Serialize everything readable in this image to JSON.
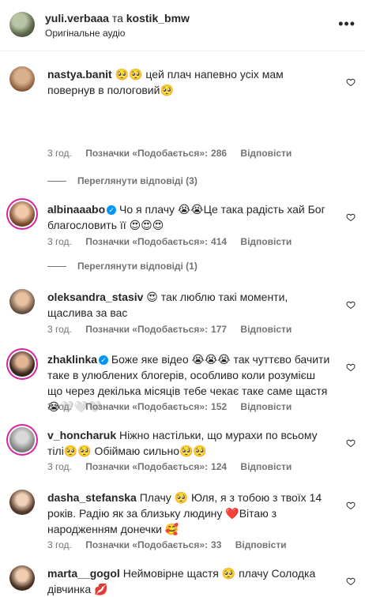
{
  "header": {
    "user1": "yuli.verbaaa",
    "separator": "та",
    "user2": "kostik_bmw",
    "audio": "Оригінальне аудіо",
    "more": "•••"
  },
  "labels": {
    "likes_prefix": "Позначки «Подобається»:",
    "reply": "Відповісти"
  },
  "comments": [
    {
      "user": "nastya.banit",
      "text": "🥺🥺 цей плач напевно усіх мам повернув в пологовий🥺",
      "time": "3 год.",
      "likes": "286",
      "replies": "Переглянути відповіді (3)"
    },
    {
      "user": "albinaaabo",
      "verified": true,
      "text": "Чо я плачу 😭😭Це така радість хай Бог благословить її 😍😍😍",
      "time": "3 год.",
      "likes": "414",
      "replies": "Переглянути відповіді (1)"
    },
    {
      "user": "oleksandra_stasiv",
      "text": "😍 так люблю такі моменти, щаслива за вас",
      "time": "3 год.",
      "likes": "177"
    },
    {
      "user": "zhaklinka",
      "verified": true,
      "text": "Боже яке відео 😭😭😭 так чуттєво бачити таке в улюблених блогерів, особливо коли розумієш що через декілька місяців тебе чекає таке саме щастя 😭🤍🤍🤍",
      "time": "3 год.",
      "likes": "152"
    },
    {
      "user": "v_honcharuk",
      "text": "Ніжно настільки, що мурахи по всьому тілі🥺🥺 Обіймаю сильно🥺🥺",
      "time": "3 год.",
      "likes": "124"
    },
    {
      "user": "dasha_stefanska",
      "text": "Плачу 🥺 Юля, я з тобою з твоїх 14 років. Радію як за близьку людину ❤️Вітаю з народженням донечки 🥰",
      "time": "3 год.",
      "likes": "33"
    },
    {
      "user": "marta__gogol",
      "text": "Неймовірне щастя 🥺 плачу Солодка дівчинка 💋",
      "time": "",
      "likes": ""
    }
  ]
}
